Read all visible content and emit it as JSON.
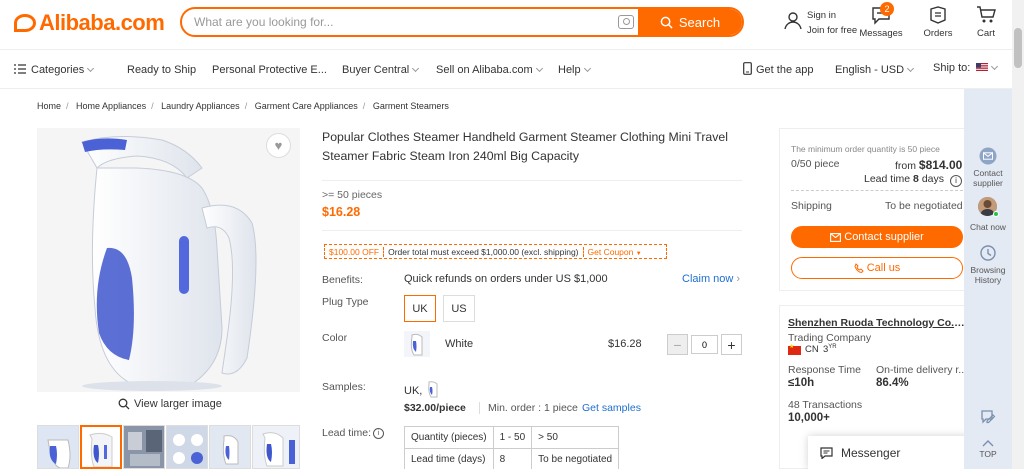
{
  "header": {
    "logo": "Alibaba.com",
    "search_placeholder": "What are you looking for...",
    "search_button": "Search",
    "sign_in": "Sign in",
    "join_free": "Join for free",
    "messages_label": "Messages",
    "messages_badge": "2",
    "orders_label": "Orders",
    "cart_label": "Cart"
  },
  "nav": {
    "categories": "Categories",
    "items": [
      "Ready to Ship",
      "Personal Protective E...",
      "Buyer Central",
      "Sell on Alibaba.com",
      "Help"
    ],
    "get_app": "Get the app",
    "language": "English - USD",
    "ship_to": "Ship to:"
  },
  "breadcrumb": [
    "Home",
    "Home Appliances",
    "Laundry Appliances",
    "Garment Care Appliances",
    "Garment Steamers"
  ],
  "gallery": {
    "view_larger": "View larger image"
  },
  "product": {
    "title": "Popular Clothes Steamer Handheld Garment Steamer Clothing Mini Travel Steamer Fabric Steam Iron 240ml Big Capacity",
    "min_qty": ">= 50 pieces",
    "price": "$16.28",
    "coupon": {
      "discount": "$100.00 OFF",
      "condition": "Order total must exceed $1,000.00 (excl. shipping)",
      "action": "Get Coupon"
    },
    "benefits_label": "Benefits:",
    "benefits_text": "Quick refunds on orders under US $1,000",
    "claim_now": "Claim now",
    "plug_type_label": "Plug Type",
    "plug_options": [
      "UK",
      "US"
    ],
    "plug_selected": "UK",
    "color_label": "Color",
    "color_name": "White",
    "color_price": "$16.28",
    "quantity_value": "0",
    "samples_label": "Samples:",
    "samples_variant": "UK,",
    "sample_price": "$32.00/piece",
    "sample_min_order": "Min. order : 1 piece",
    "get_samples": "Get samples",
    "lead_time_label": "Lead time:",
    "lead_time_table": {
      "row1": [
        "Quantity (pieces)",
        "1 - 50",
        "> 50"
      ],
      "row2": [
        "Lead time (days)",
        "8",
        "To be negotiated"
      ]
    }
  },
  "order_panel": {
    "min_order_note": "The minimum order quantity is 50 piece",
    "piece_count": "0/50 piece",
    "from_label": "from",
    "from_price": "$814.00",
    "lead_time_label": "Lead time",
    "lead_time_days": "8",
    "lead_time_unit": "days",
    "shipping_label": "Shipping",
    "shipping_value": "To be negotiated",
    "contact_supplier": "Contact supplier",
    "call_us": "Call us"
  },
  "supplier": {
    "name": "Shenzhen Ruoda Technology Co., ...",
    "type": "Trading Company",
    "country": "CN",
    "years": "3",
    "years_unit": "YR",
    "response_time_label": "Response Time",
    "response_time_value": "≤10h",
    "ontime_label": "On-time delivery r...",
    "ontime_value": "86.4%",
    "transactions_label": "48 Transactions",
    "transactions_value": "10,000+"
  },
  "messenger": "Messenger",
  "sidebar": {
    "contact": "Contact supplier",
    "chat": "Chat now",
    "history": "Browsing History",
    "top": "TOP"
  },
  "colors": {
    "accent": "#ff6a00",
    "link": "#1d6fcf",
    "sidebar": "#e4eaf3"
  }
}
